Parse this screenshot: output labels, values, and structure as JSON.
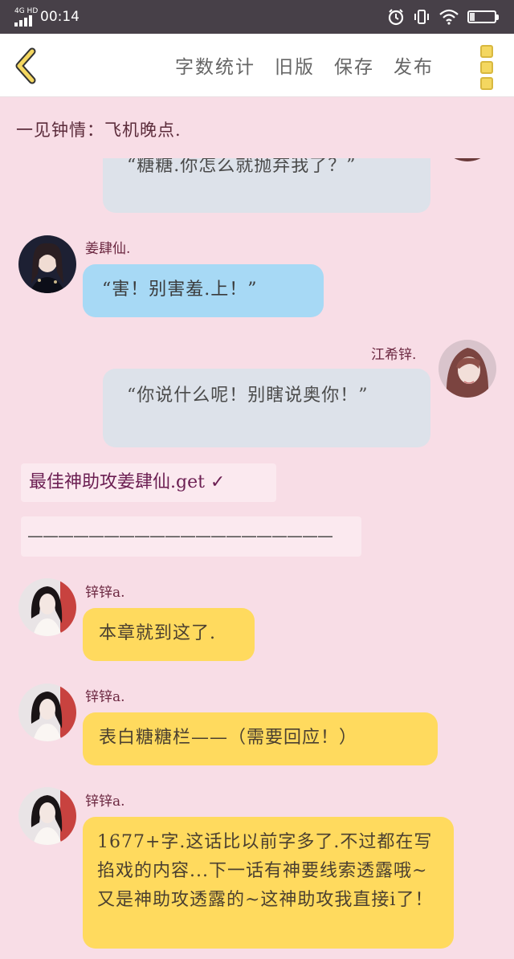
{
  "status_bar": {
    "network": "4G HD",
    "time": "00:14",
    "battery": "19",
    "battery_level": 0.19,
    "icons": [
      "alarm-icon",
      "vibrate-icon",
      "wifi-icon",
      "battery-icon"
    ]
  },
  "toolbar": {
    "back_icon": "chevron-left-icon",
    "actions": [
      "字数统计",
      "旧版",
      "保存",
      "发布"
    ],
    "more_icon": "more-vertical-icon",
    "accent": "#f4d760"
  },
  "story_title": "一见钟情：飞机晚点.",
  "messages": [
    {
      "side": "right",
      "sender": "",
      "text": "“糖糖.你怎么就抛弃我了？”",
      "style": "gray",
      "partial": true
    },
    {
      "side": "left",
      "sender": "姜肆仙.",
      "text": "“害！别害羞.上！”",
      "style": "blue"
    },
    {
      "side": "right",
      "sender": "江希锌.",
      "text": "“你说什么呢！别瞎说奥你！”",
      "style": "gray"
    }
  ],
  "caption": "最佳神助攻姜肆仙.get ✓",
  "divider": "————————————————————",
  "notes": [
    {
      "sender": "锌锌a.",
      "text": "本章就到这了."
    },
    {
      "sender": "锌锌a.",
      "text": "表白糖糖栏——（需要回应！）"
    },
    {
      "sender": "锌锌a.",
      "text": "1677+字.这话比以前字多了.不过都在写掐戏的内容...下一话有神要线索透露哦~又是神助攻透露的~这神助攻我直接i了！"
    }
  ],
  "colors": {
    "background": "#f8dde6",
    "status_bar": "#474048",
    "bubble_gray": "#dde2ea",
    "bubble_blue": "#a7d9f5",
    "bubble_yellow": "#ffda5e",
    "sender_text": "#6b2740"
  }
}
